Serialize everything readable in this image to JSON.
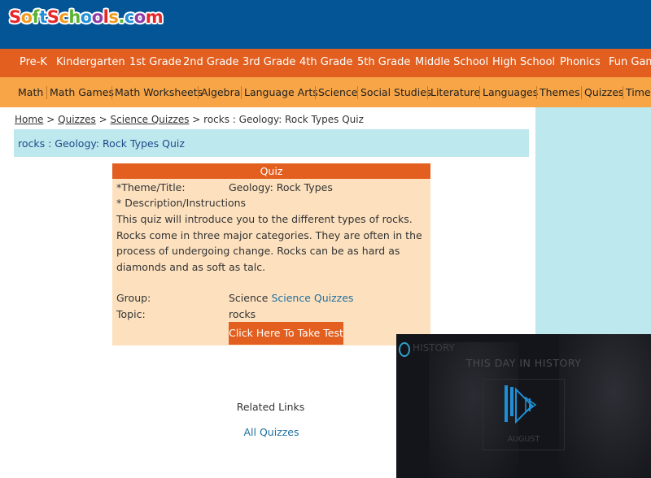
{
  "header": {
    "logo_text": [
      "S",
      "o",
      "f",
      "t",
      "S",
      "c",
      "h",
      "o",
      "o",
      "l",
      "s",
      ".",
      "c",
      "o",
      "m"
    ],
    "logo_colors": [
      "#e8262a",
      "#f39a1b",
      "#5cb230",
      "#1f8fd6",
      "#e8262a",
      "#f39a1b",
      "#5cb230",
      "#1f8fd6",
      "#8e3ba6",
      "#e8262a",
      "#f39a1b",
      "#5cb230",
      "#1f8fd6",
      "#8e3ba6",
      "#e8262a"
    ]
  },
  "nav_primary": {
    "items": [
      {
        "label": "Pre-K"
      },
      {
        "label": "Kindergarten"
      },
      {
        "label": "1st Grade"
      },
      {
        "label": "2nd Grade"
      },
      {
        "label": "3rd Grade"
      },
      {
        "label": "4th Grade"
      },
      {
        "label": "5th Grade"
      },
      {
        "label": "Middle School"
      },
      {
        "label": "High School"
      },
      {
        "label": "Phonics"
      },
      {
        "label": "Fun Gam"
      }
    ]
  },
  "nav_secondary": {
    "items": [
      {
        "label": "Math"
      },
      {
        "label": "Math Games"
      },
      {
        "label": "Math Worksheets"
      },
      {
        "label": "Algebra"
      },
      {
        "label": "Language Arts"
      },
      {
        "label": "Science"
      },
      {
        "label": "Social Studies"
      },
      {
        "label": "Literature"
      },
      {
        "label": "Languages"
      },
      {
        "label": "Themes"
      },
      {
        "label": "Quizzes"
      },
      {
        "label": "Timel"
      }
    ]
  },
  "breadcrumb": {
    "home": "Home",
    "sep": ">",
    "quizzes": "Quizzes",
    "science_quizzes": "Science Quizzes",
    "current": "rocks : Geology: Rock Types Quiz"
  },
  "page_title": "rocks : Geology: Rock Types Quiz",
  "quiz": {
    "heading": "Quiz",
    "theme_label": "*Theme/Title:",
    "theme_value": "Geology: Rock Types",
    "desc_label": "* Description/Instructions",
    "description": "This quiz will introduce you to the different types of rocks. Rocks come in three major categories. They are often in the process of undergoing change. Rocks can be as hard as diamonds and as soft as talc.",
    "group_label": "Group:",
    "group_value": "Science",
    "group_link": "Science Quizzes",
    "topic_label": "Topic:",
    "topic_value": "rocks",
    "take_test": "Click Here To Take Test"
  },
  "related": {
    "heading": "Related Links",
    "all_quizzes": "All Quizzes"
  },
  "video": {
    "brand": "HISTORY",
    "title": "THIS DAY IN HISTORY",
    "month": "AUGUST"
  }
}
